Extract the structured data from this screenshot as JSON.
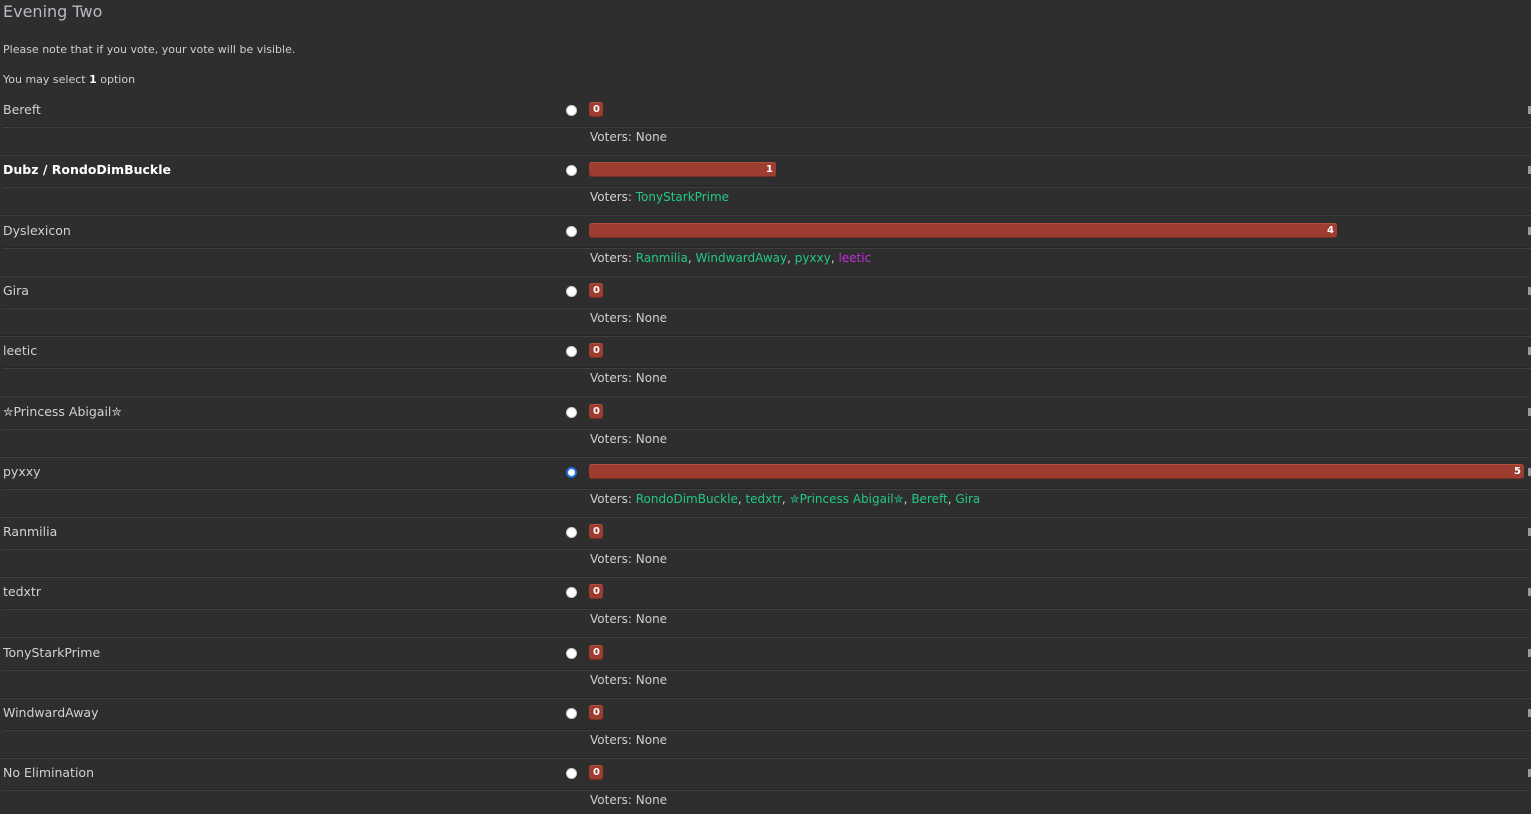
{
  "poll": {
    "title": "Evening Two",
    "note": "Please note that if you vote, your vote will be visible.",
    "select_prefix": "You may select ",
    "select_count": "1",
    "select_suffix": " option",
    "voters_label": "Voters: ",
    "none_label": "None",
    "max_votes": 5,
    "bar_color": "#9c3d2f",
    "voter_color": "#22c983",
    "special_voter_color": "#c22ddb",
    "options": [
      {
        "name": "Bereft",
        "votes": 0,
        "selected": false,
        "bold": false,
        "voters": []
      },
      {
        "name": "Dubz / RondoDimBuckle",
        "votes": 1,
        "selected": false,
        "bold": true,
        "voters": [
          "TonyStarkPrime"
        ]
      },
      {
        "name": "Dyslexicon",
        "votes": 4,
        "selected": false,
        "bold": false,
        "voters": [
          "Ranmilia",
          "WindwardAway",
          "pyxxy",
          "leetic"
        ]
      },
      {
        "name": "Gira",
        "votes": 0,
        "selected": false,
        "bold": false,
        "voters": []
      },
      {
        "name": "leetic",
        "votes": 0,
        "selected": false,
        "bold": false,
        "voters": []
      },
      {
        "name": "✮Princess Abigail✮",
        "votes": 0,
        "selected": false,
        "bold": false,
        "voters": []
      },
      {
        "name": "pyxxy",
        "votes": 5,
        "selected": true,
        "bold": false,
        "voters": [
          "RondoDimBuckle",
          "tedxtr",
          "✮Princess Abigail✮",
          "Bereft",
          "Gira"
        ]
      },
      {
        "name": "Ranmilia",
        "votes": 0,
        "selected": false,
        "bold": false,
        "voters": []
      },
      {
        "name": "tedxtr",
        "votes": 0,
        "selected": false,
        "bold": false,
        "voters": []
      },
      {
        "name": "TonyStarkPrime",
        "votes": 0,
        "selected": false,
        "bold": false,
        "voters": []
      },
      {
        "name": "WindwardAway",
        "votes": 0,
        "selected": false,
        "bold": false,
        "voters": []
      },
      {
        "name": "No Elimination",
        "votes": 0,
        "selected": false,
        "bold": false,
        "voters": []
      }
    ]
  }
}
